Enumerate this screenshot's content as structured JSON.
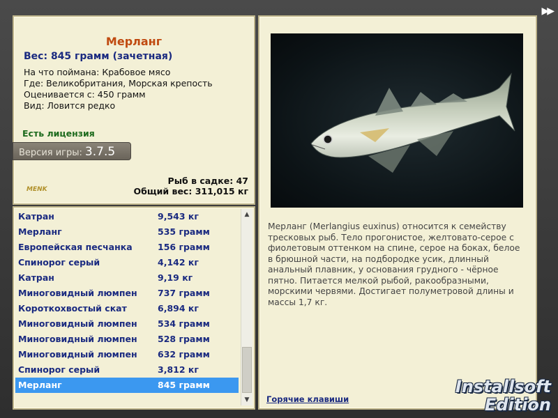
{
  "fish_info": {
    "name": "Мерланг",
    "weight": "Вес: 845 грамм (зачетная)",
    "caught_on": "На что поймана: Крабовое мясо",
    "location": "Где: Великобритания, Морская крепость",
    "valued_from": "Оценивается с: 450 грамм",
    "rarity": "Вид: Ловится редко",
    "license": "Есть лицензия"
  },
  "version": {
    "label": "Версия игры:",
    "number": "3.7.5"
  },
  "stats": {
    "fish_count": "Рыб в садке: 47",
    "total_weight": "Общий вес: 311,015 кг"
  },
  "small_logo": "MENK",
  "fish_list": [
    {
      "name": "Катран",
      "weight": "9,543 кг"
    },
    {
      "name": "Мерланг",
      "weight": "535 грамм"
    },
    {
      "name": "Европейская песчанка",
      "weight": "156 грамм"
    },
    {
      "name": "Спинорог серый",
      "weight": "4,142 кг"
    },
    {
      "name": "Катран",
      "weight": "9,19 кг"
    },
    {
      "name": "Миноговидный люмпен",
      "weight": "737 грамм"
    },
    {
      "name": "Короткохвостый скат",
      "weight": "6,894 кг"
    },
    {
      "name": "Миноговидный люмпен",
      "weight": "534 грамм"
    },
    {
      "name": "Миноговидный люмпен",
      "weight": "528 грамм"
    },
    {
      "name": "Миноговидный люмпен",
      "weight": "632 грамм"
    },
    {
      "name": "Спинорог серый",
      "weight": "3,812 кг"
    },
    {
      "name": "Мерланг",
      "weight": "845 грамм"
    }
  ],
  "selected_index": 11,
  "description": "Мерланг (Merlangius euxinus) относится к семейству тресковых рыб. Тело прогонистое, желтовато-серое с фиолетовым оттенком на спине, серое на боках, белое в брюшной части, на подбородке усик, длинный анальный плавник, у основания грудного - чёрное пятно. Питается мелкой рыбой, ракообразными, морскими червями. Достигает полуметровой длины и массы 1,7 кг.",
  "hotkeys_link": "Горячие клавиши",
  "brand": {
    "line1": "Installsoft",
    "line2": "Edition"
  },
  "nav_icon": "fast-forward-icon",
  "colors": {
    "panel_bg": "#f3f0d6",
    "title": "#c04a10",
    "list_text": "#1a2a80",
    "selection": "#3b98f0",
    "license": "#1d6a1d"
  }
}
